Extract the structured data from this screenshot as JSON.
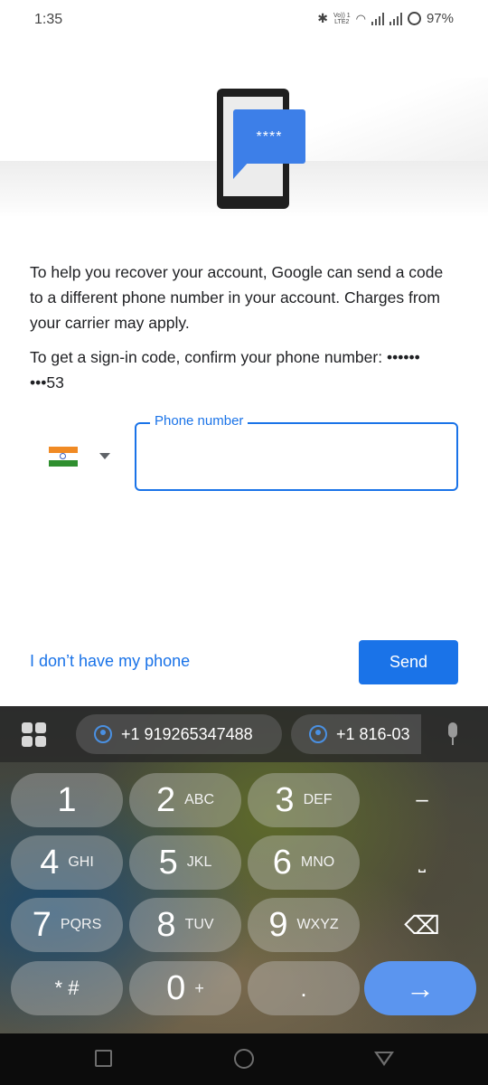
{
  "status_bar": {
    "time": "1:35",
    "volte_top": "Vo)) 1",
    "volte_bottom": "LTE2",
    "battery": "97%"
  },
  "hero": {
    "masked_code": "****"
  },
  "content": {
    "description": "To help you recover your account, Google can send a code to a different phone number in your account. Charges from your carrier may apply.",
    "confirm_text": "To get a sign-in code, confirm your phone number: ••••••\n•••53",
    "country_flag": "india-flag-icon",
    "phone_field": {
      "label": "Phone number",
      "value": "",
      "placeholder": ""
    },
    "no_phone_link": "I don’t have my phone",
    "send_button": "Send"
  },
  "keyboard": {
    "suggestions": [
      "+1 919265347488",
      "+1 816-03"
    ],
    "keys": [
      {
        "digit": "1",
        "letters": ""
      },
      {
        "digit": "2",
        "letters": "ABC"
      },
      {
        "digit": "3",
        "letters": "DEF"
      },
      {
        "digit": "–",
        "letters": ""
      },
      {
        "digit": "4",
        "letters": "GHI"
      },
      {
        "digit": "5",
        "letters": "JKL"
      },
      {
        "digit": "6",
        "letters": "MNO"
      },
      {
        "digit": "⎵",
        "letters": ""
      },
      {
        "digit": "7",
        "letters": "PQRS"
      },
      {
        "digit": "8",
        "letters": "TUV"
      },
      {
        "digit": "9",
        "letters": "WXYZ"
      },
      {
        "digit": "⌫",
        "letters": ""
      },
      {
        "digit": "* #",
        "letters": ""
      },
      {
        "digit": "0",
        "letters": "+"
      },
      {
        "digit": ".",
        "letters": ""
      },
      {
        "digit": "→",
        "letters": ""
      }
    ]
  },
  "colors": {
    "accent": "#1a73e8",
    "bubble": "#3d7fe8",
    "enter_key": "#5b95ef"
  }
}
